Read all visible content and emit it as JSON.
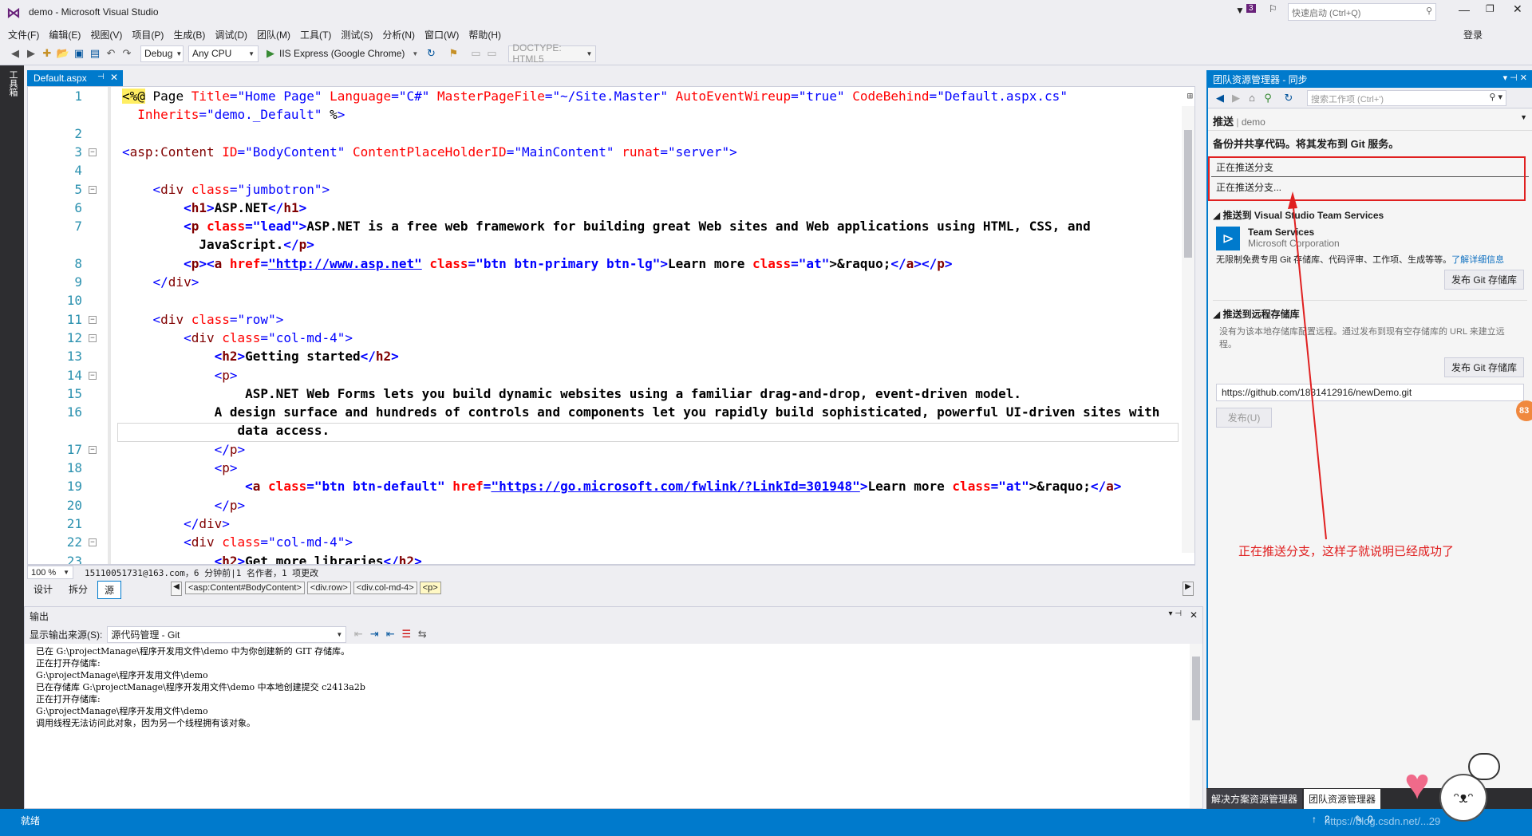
{
  "window": {
    "title": "demo - Microsoft Visual Studio",
    "notif_count": "3",
    "quick_launch_placeholder": "快速启动 (Ctrl+Q)",
    "login": "登录"
  },
  "menu": [
    "文件(F)",
    "编辑(E)",
    "视图(V)",
    "项目(P)",
    "生成(B)",
    "调试(D)",
    "团队(M)",
    "工具(T)",
    "测试(S)",
    "分析(N)",
    "窗口(W)",
    "帮助(H)"
  ],
  "toolbar": {
    "config": "Debug",
    "platform": "Any CPU",
    "run_target": "IIS Express (Google Chrome)",
    "doctype": "DOCTYPE: HTML5"
  },
  "leftstrip": {
    "label": "工具箱"
  },
  "editor": {
    "tab": "Default.aspx",
    "zoom": "100 %",
    "status": "15110051731@163.com，6 分钟前|1 名作者，1 项更改",
    "view_tabs": [
      "设计",
      "拆分",
      "源"
    ],
    "breadcrumbs": [
      "<asp:Content#BodyContent>",
      "<div.row>",
      "<div.col-md-4>",
      "<p>"
    ]
  },
  "code_lines": [
    {
      "n": "1",
      "t": "<%@ Page Title=\"Home Page\" Language=\"C#\" MasterPageFile=\"~/Site.Master\" AutoEventWireup=\"true\" CodeBehind=\"Default.aspx.cs\""
    },
    {
      "n": "",
      "t": "  Inherits=\"demo._Default\" %>"
    },
    {
      "n": "2",
      "t": ""
    },
    {
      "n": "3",
      "t": "<asp:Content ID=\"BodyContent\" ContentPlaceHolderID=\"MainContent\" runat=\"server\">"
    },
    {
      "n": "4",
      "t": ""
    },
    {
      "n": "5",
      "t": "    <div class=\"jumbotron\">"
    },
    {
      "n": "6",
      "t": "        <h1>ASP.NET</h1>"
    },
    {
      "n": "7",
      "t": "        <p class=\"lead\">ASP.NET is a free web framework for building great Web sites and Web applications using HTML, CSS, and"
    },
    {
      "n": "",
      "t": "          JavaScript.</p>"
    },
    {
      "n": "8",
      "t": "        <p><a href=\"http://www.asp.net\" class=\"btn btn-primary btn-lg\">Learn more &raquo;</a></p>"
    },
    {
      "n": "9",
      "t": "    </div>"
    },
    {
      "n": "10",
      "t": ""
    },
    {
      "n": "11",
      "t": "    <div class=\"row\">"
    },
    {
      "n": "12",
      "t": "        <div class=\"col-md-4\">"
    },
    {
      "n": "13",
      "t": "            <h2>Getting started</h2>"
    },
    {
      "n": "14",
      "t": "            <p>"
    },
    {
      "n": "15",
      "t": "                ASP.NET Web Forms lets you build dynamic websites using a familiar drag-and-drop, event-driven model."
    },
    {
      "n": "16",
      "t": "            A design surface and hundreds of controls and components let you rapidly build sophisticated, powerful UI-driven sites with"
    },
    {
      "n": "",
      "t": "               data access."
    },
    {
      "n": "17",
      "t": "            </p>"
    },
    {
      "n": "18",
      "t": "            <p>"
    },
    {
      "n": "19",
      "t": "                <a class=\"btn btn-default\" href=\"https://go.microsoft.com/fwlink/?LinkId=301948\">Learn more &raquo;</a>"
    },
    {
      "n": "20",
      "t": "            </p>"
    },
    {
      "n": "21",
      "t": "        </div>"
    },
    {
      "n": "22",
      "t": "        <div class=\"col-md-4\">"
    },
    {
      "n": "23",
      "t": "            <h2>Get more libraries</h2>"
    }
  ],
  "output": {
    "title": "输出",
    "source_label": "显示输出来源(S):",
    "source_value": "源代码管理 - Git",
    "lines": [
      "已在 G:\\projectManage\\程序开发用文件\\demo 中为你创建新的 GIT 存储库。",
      "正在打开存储库:",
      "G:\\projectManage\\程序开发用文件\\demo",
      "已在存储库 G:\\projectManage\\程序开发用文件\\demo 中本地创建提交 c2413a2b",
      "正在打开存储库:",
      "G:\\projectManage\\程序开发用文件\\demo",
      "调用线程无法访问此对象，因为另一个线程拥有该对象。"
    ]
  },
  "team": {
    "title": "团队资源管理器 - 同步",
    "search_placeholder": "搜索工作项 (Ctrl+')",
    "section": "推送",
    "repo": "demo",
    "subtitle": "备份并共享代码。将其发布到 Git 服务。",
    "push_status_1": "正在推送分支",
    "push_status_2": "正在推送分支...",
    "vsts_title": "推送到 Visual Studio Team Services",
    "vsts_name": "Team Services",
    "vsts_company": "Microsoft Corporation",
    "vsts_desc": "无限制免费专用 Git 存储库、代码评审、工作项、生成等等。",
    "vsts_link": "了解详细信息",
    "publish_git_btn": "发布 Git 存储库",
    "remote_title": "推送到远程存储库",
    "remote_desc": "没有为该本地存储库配置远程。通过发布到现有空存储库的 URL 来建立远程。",
    "remote_btn": "发布 Git 存储库",
    "remote_url": "https://github.com/1831412916/newDemo.git",
    "publish_btn": "发布(U)",
    "tabs": [
      "解决方案资源管理器",
      "团队资源管理器"
    ],
    "badge": "83"
  },
  "annotation": "正在推送分支，这样子就说明已经成功了",
  "statusbar": {
    "left": "就绪",
    "up": "2",
    "pencil": "0",
    "watermark": "https://blog.csdn.net/...29"
  },
  "colors": {
    "accent": "#007acc",
    "annotation": "#e02020"
  }
}
